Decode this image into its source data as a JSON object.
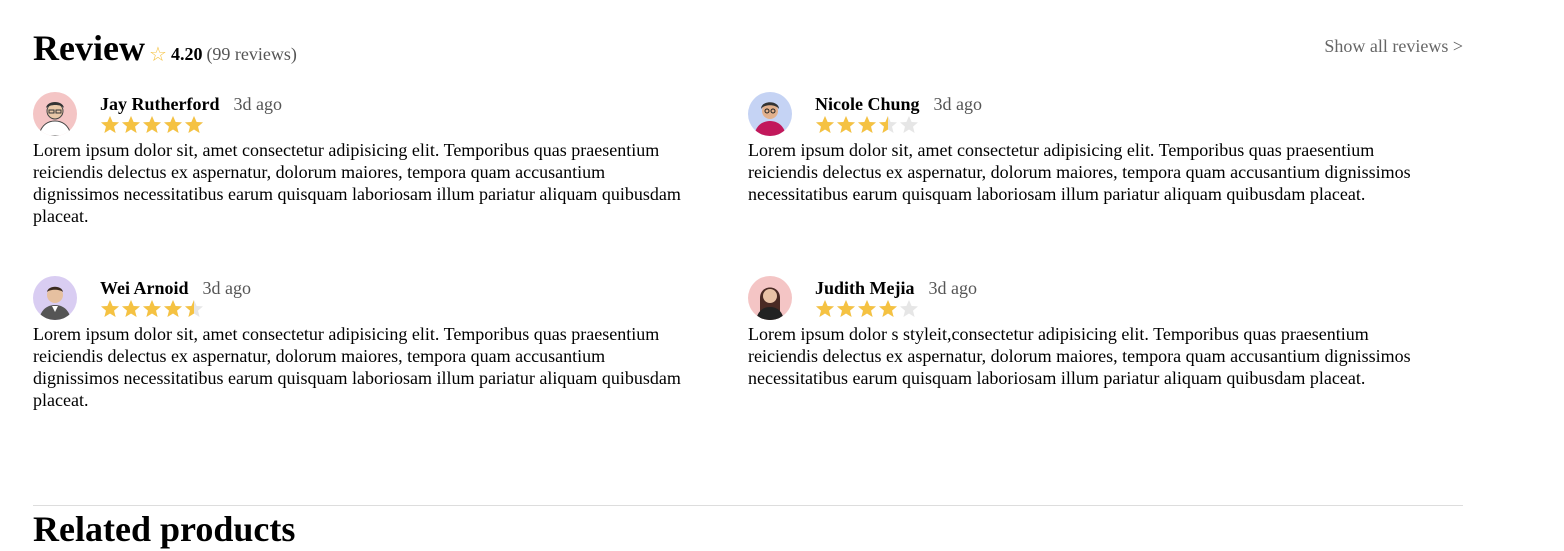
{
  "review_section": {
    "title": "Review",
    "star_icon": "star-outline-icon",
    "average_rating": "4.20",
    "review_count": "(99 reviews)",
    "show_all_label": "Show all reviews >"
  },
  "colors": {
    "star_filled": "#f5c242",
    "star_empty": "#e6e6e6",
    "muted_text": "#555555",
    "divider": "#dddddd"
  },
  "reviews": [
    {
      "name": "Jay Rutherford",
      "time": "3d ago",
      "rating": 5,
      "avatar_bg": "#f4c5c5",
      "text": "Lorem ipsum dolor sit, amet consectetur adipisicing elit. Temporibus quas praesentium reiciendis delectus ex aspernatur, dolorum maiores, tempora quam accusantium dignissimos necessitatibus earum quisquam laboriosam illum pariatur aliquam quibusdam placeat."
    },
    {
      "name": "Nicole Chung",
      "time": "3d ago",
      "rating": 3.5,
      "avatar_bg": "#c5d3f4",
      "text": "Lorem ipsum dolor sit, amet consectetur adipisicing elit. Temporibus quas praesentium reiciendis delectus ex aspernatur, dolorum maiores, tempora quam accusantium dignissimos necessitatibus earum quisquam laboriosam illum pariatur aliquam quibusdam placeat."
    },
    {
      "name": "Wei Arnoid",
      "time": "3d ago",
      "rating": 4.5,
      "avatar_bg": "#d9cdf2",
      "text": "Lorem ipsum dolor sit, amet consectetur adipisicing elit. Temporibus quas praesentium reiciendis delectus ex aspernatur, dolorum maiores, tempora quam accusantium dignissimos necessitatibus earum quisquam laboriosam illum pariatur aliquam quibusdam placeat."
    },
    {
      "name": "Judith Mejia",
      "time": "3d ago",
      "rating": 4,
      "avatar_bg": "#f4c5c5",
      "text": "Lorem ipsum dolor s styleit,consectetur adipisicing elit. Temporibus quas praesentium reiciendis delectus ex aspernatur, dolorum maiores, tempora quam accusantium dignissimos necessitatibus earum quisquam laboriosam illum pariatur aliquam quibusdam placeat."
    }
  ],
  "related": {
    "title": "Related products"
  }
}
